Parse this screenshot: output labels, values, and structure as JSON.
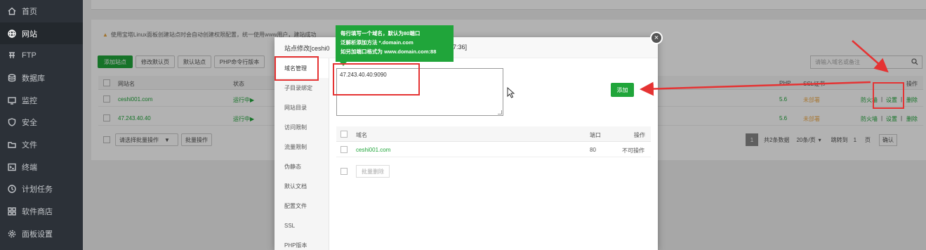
{
  "sidebar": {
    "items": [
      {
        "label": "首页",
        "icon": "home-icon"
      },
      {
        "label": "网站",
        "icon": "globe-icon",
        "active": true
      },
      {
        "label": "FTP",
        "icon": "ftp-icon"
      },
      {
        "label": "数据库",
        "icon": "database-icon"
      },
      {
        "label": "监控",
        "icon": "monitor-icon"
      },
      {
        "label": "安全",
        "icon": "shield-icon"
      },
      {
        "label": "文件",
        "icon": "folder-icon"
      },
      {
        "label": "终端",
        "icon": "terminal-icon"
      },
      {
        "label": "计划任务",
        "icon": "clock-icon"
      },
      {
        "label": "软件商店",
        "icon": "grid-icon"
      },
      {
        "label": "面板设置",
        "icon": "gear-icon"
      }
    ]
  },
  "page": {
    "tip": "使用宝塔Linux面板创建站点时会自动创建权限配置，统一使用www用户，建站成功",
    "toolbar": {
      "add_site": "添加站点",
      "edit_default_page": "修改默认页",
      "default_site": "默认站点",
      "php_cli": "PHP命令行版本"
    },
    "search_placeholder": "请输入域名或备注",
    "table": {
      "headers": {
        "name": "网站名",
        "status": "状态",
        "php": "PHP",
        "ssl": "SSL证书",
        "ops": "操作"
      },
      "rows": [
        {
          "name": "ceshi001.com",
          "status": "运行中▶",
          "php": "5.6",
          "ssl": "未部署",
          "firewall": "防火墙",
          "settings": "设置",
          "delete": "删除",
          "sep1": "|",
          "sep2": "|"
        },
        {
          "name": "47.243.40.40",
          "status": "运行中▶",
          "php": "5.6",
          "ssl": "未部署",
          "firewall": "防火墙",
          "settings": "设置",
          "delete": "删除",
          "sep1": "|",
          "sep2": "|"
        }
      ]
    },
    "batch_select": "请选择批量操作",
    "batch_action": "批量操作",
    "pager": {
      "current": "1",
      "total": "共2条数据",
      "per_page": "20条/页",
      "goto": "跳转到",
      "goto_value": "1",
      "page_unit": "页",
      "confirm": "确认"
    }
  },
  "modal": {
    "title": "站点修改[ceshi0",
    "title_tail": "7:36]",
    "close": "×",
    "menu": [
      "域名管理",
      "子目录绑定",
      "网站目录",
      "访问限制",
      "流量限制",
      "伪静态",
      "默认文档",
      "配置文件",
      "SSL",
      "PHP版本"
    ],
    "textarea_value": "47.243.40.40:9090",
    "add_button": "添加",
    "domain_table": {
      "headers": {
        "domain": "域名",
        "port": "端口",
        "ops": "操作"
      },
      "rows": [
        {
          "domain": "ceshi001.com",
          "port": "80",
          "op": "不可操作"
        }
      ]
    },
    "batch_delete": "批量删除"
  },
  "tooltip": {
    "lines": [
      "每行填写一个域名，默认为80端口",
      "泛解析添加方法 *.domain.com",
      "如另加端口格式为 www.domain.com:88"
    ]
  },
  "colors": {
    "brand_green": "#20a53a",
    "annotation_red": "#e53333",
    "sidebar_bg": "#2c3138"
  }
}
